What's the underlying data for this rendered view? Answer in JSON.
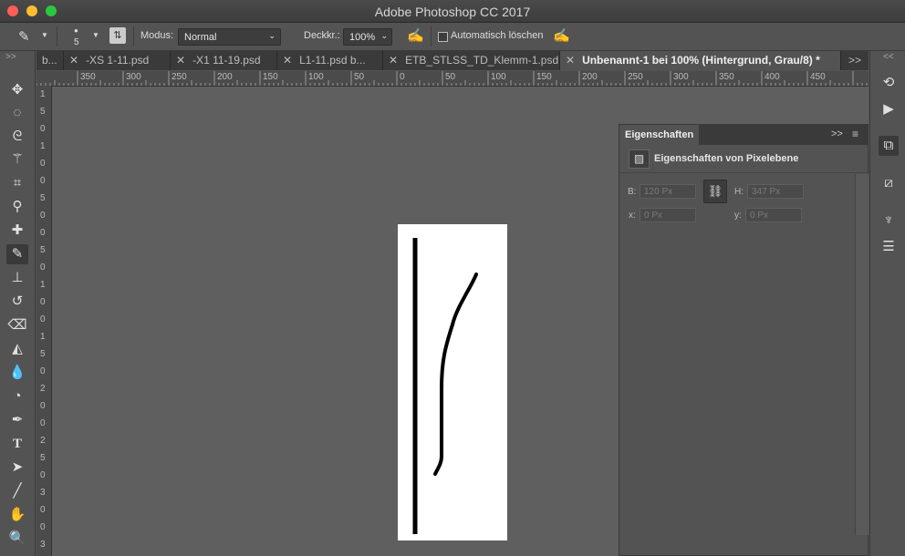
{
  "app": {
    "title": "Adobe Photoshop CC 2017"
  },
  "colors": {
    "close": "#ff5f57",
    "minimize": "#febc2e",
    "zoom": "#28c840"
  },
  "options": {
    "brush_size": "5",
    "mode_label": "Modus:",
    "mode_value": "Normal",
    "opacity_label": "Deckkr.:",
    "opacity_value": "100%",
    "auto_erase_label": "Automatisch löschen"
  },
  "tabs": [
    {
      "label": "b..."
    },
    {
      "label": "-XS 1-11.psd"
    },
    {
      "label": "-X1 11-19.psd"
    },
    {
      "label": "L1-11.psd b..."
    },
    {
      "label": "ETB_STLSS_TD_Klemm-1.psd"
    },
    {
      "label": "Unbenannt-1 bei 100% (Hintergrund, Grau/8) *"
    }
  ],
  "tab_more": ">>",
  "toolbar_collapse": ">>",
  "dock_collapse": "<<",
  "ruler_h": [
    "350",
    "300",
    "250",
    "200",
    "150",
    "100",
    "50",
    "0",
    "50",
    "100",
    "150",
    "200",
    "250",
    "300",
    "350",
    "400",
    "450"
  ],
  "ruler_v": [
    "1",
    "5",
    "0",
    "1",
    "0",
    "0",
    "5",
    "0",
    "0",
    "5",
    "0",
    "1",
    "0",
    "0",
    "1",
    "5",
    "0",
    "2",
    "0",
    "0",
    "2",
    "5",
    "0",
    "3",
    "0",
    "0",
    "3"
  ],
  "panel": {
    "tab": "Eigenschaften",
    "more": ">>",
    "heading": "Eigenschaften von Pixelebene",
    "b_label": "B:",
    "b_value": "120 Px",
    "h_label": "H:",
    "h_value": "347 Px",
    "x_label": "x:",
    "x_value": "0 Px",
    "y_label": "y:",
    "y_value": "0 Px"
  }
}
